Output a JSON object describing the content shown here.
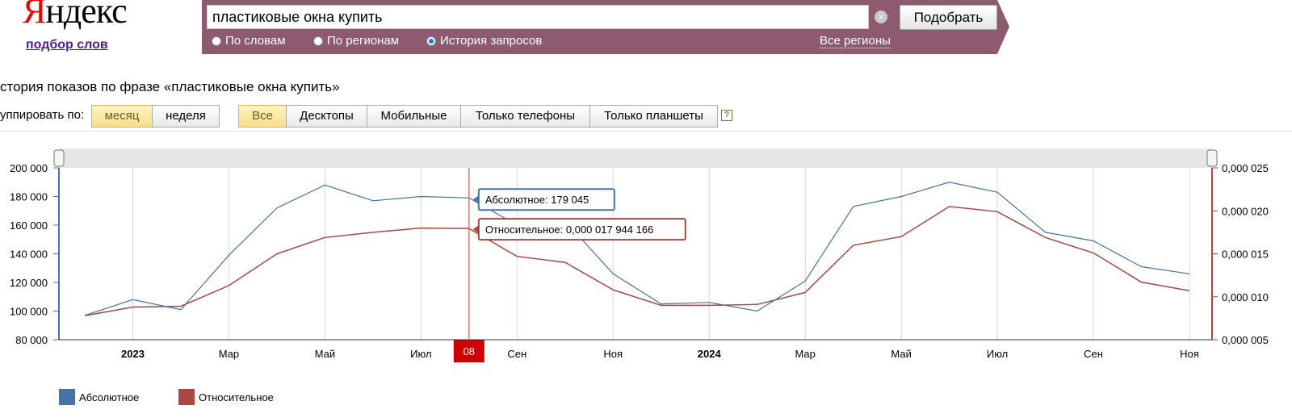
{
  "logo": {
    "text_first": "Я",
    "text_rest": "ндекс",
    "subtitle": "подбор слов"
  },
  "search": {
    "value": "пластиковые окна купить",
    "clear_icon": "clear-icon",
    "button_label": "Подобрать"
  },
  "modes": [
    {
      "label": "По словам",
      "selected": false
    },
    {
      "label": "По регионам",
      "selected": false
    },
    {
      "label": "История запросов",
      "selected": true
    }
  ],
  "regions_link": "Все регионы",
  "heading": "стория показов по фразе «пластиковые окна купить»",
  "group": {
    "label": "уппировать по:",
    "options": [
      {
        "label": "месяц",
        "active": true
      },
      {
        "label": "неделя",
        "active": false
      }
    ]
  },
  "devices": [
    {
      "label": "Все",
      "active": true
    },
    {
      "label": "Десктопы",
      "active": false
    },
    {
      "label": "Мобильные",
      "active": false
    },
    {
      "label": "Только телефоны",
      "active": false
    },
    {
      "label": "Только планшеты",
      "active": false
    }
  ],
  "help_icon": "?",
  "colors": {
    "brand_bar": "#8e5a70",
    "absolute": "#4572a7",
    "relative": "#aa4643",
    "marker": "#cc0000"
  },
  "chart_data": {
    "type": "line",
    "x_tick_labels": [
      "2023",
      "Мар",
      "Май",
      "Июл",
      "Сен",
      "Ноя",
      "2024",
      "Мар",
      "Май",
      "Июл",
      "Сен",
      "Ноя"
    ],
    "x_tick_bold": [
      true,
      false,
      false,
      false,
      false,
      false,
      true,
      false,
      false,
      false,
      false,
      false
    ],
    "x_months": [
      "2022-12",
      "2023-01",
      "2023-02",
      "2023-03",
      "2023-04",
      "2023-05",
      "2023-06",
      "2023-07",
      "2023-08",
      "2023-09",
      "2023-10",
      "2023-11",
      "2023-12",
      "2024-01",
      "2024-02",
      "2024-03",
      "2024-04",
      "2024-05",
      "2024-06",
      "2024-07",
      "2024-08",
      "2024-09",
      "2024-10",
      "2024-11"
    ],
    "series": [
      {
        "name": "Абсолютное",
        "axis": "left",
        "values": [
          97000,
          108000,
          101000,
          139000,
          172000,
          188000,
          177000,
          180000,
          179045,
          160000,
          163000,
          126000,
          105000,
          106000,
          100000,
          121000,
          173000,
          180000,
          190000,
          183000,
          155000,
          149000,
          131000,
          126000
        ]
      },
      {
        "name": "Относительное",
        "axis": "right",
        "values": [
          0.0078,
          0.0088,
          0.0089,
          0.0113,
          0.015,
          0.0169,
          0.0175,
          0.018,
          1.7944166e-05,
          0.0147,
          0.014,
          0.0108,
          0.009,
          0.009,
          0.0091,
          0.0105,
          0.016,
          0.017,
          0.0205,
          0.0199,
          0.0169,
          0.0151,
          0.0117,
          0.0107
        ]
      }
    ],
    "y_left": {
      "ticks": [
        "200 000",
        "180 000",
        "160 000",
        "140 000",
        "120 000",
        "100 000",
        "80 000"
      ],
      "range": [
        80000,
        200000
      ]
    },
    "y_right": {
      "ticks": [
        "0,000 025",
        "0,000 020",
        "0,000 015",
        "0,000 010",
        "0,000 005"
      ],
      "range": [
        0.005,
        0.025
      ]
    },
    "grid": true,
    "legend_position": "bottom-left",
    "hover": {
      "index": 8,
      "marker_label": "08",
      "tooltip_absolute": "Абсолютное: 179 045",
      "tooltip_relative": "Относительное: 0,000 017 944 166"
    }
  },
  "legend": [
    {
      "label": "Абсолютное"
    },
    {
      "label": "Относительное"
    }
  ]
}
